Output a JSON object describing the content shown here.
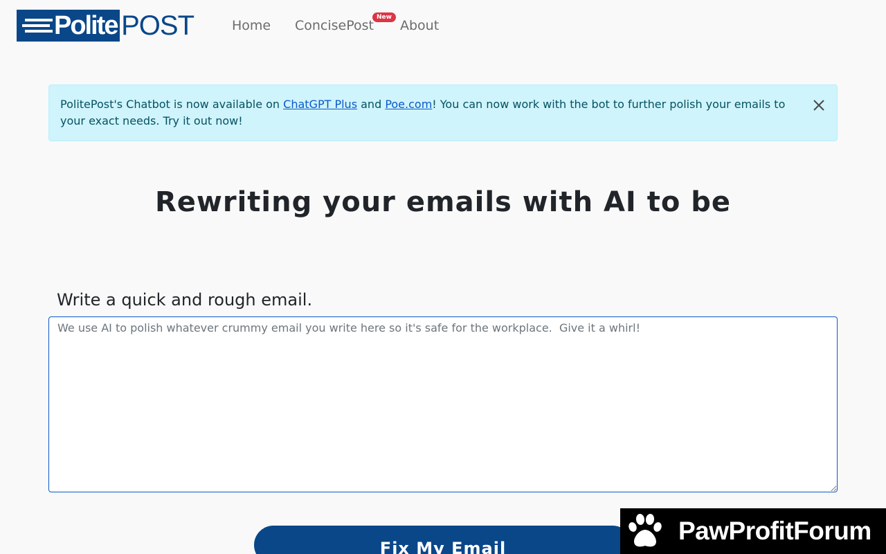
{
  "brand": {
    "logo_part1": "Polite",
    "logo_part2": "POST",
    "color": "#0a4789"
  },
  "nav": {
    "items": [
      {
        "label": "Home"
      },
      {
        "label": "ConcisePost",
        "badge": "New"
      },
      {
        "label": "About"
      }
    ],
    "badge_color": "#dc3545"
  },
  "alert": {
    "text_before": "PolitePost's Chatbot is now available on ",
    "link1": "ChatGPT Plus",
    "text_middle": " and ",
    "link2": "Poe.com",
    "text_after": "! You can now work with the bot to further polish your emails to your exact needs. Try it out now!",
    "close_icon": "close-icon",
    "background": "#cff4fc"
  },
  "hero": {
    "headline": "Rewriting your emails with AI to be"
  },
  "form": {
    "label": "Write a quick and rough email.",
    "placeholder": "We use AI to polish whatever crummy email you write here so it's safe for the workplace.  Give it a whirl!",
    "value": "",
    "submit_label": "Fix My Email"
  },
  "watermark": {
    "text": "PawProfitForum",
    "icon": "paw-icon"
  }
}
